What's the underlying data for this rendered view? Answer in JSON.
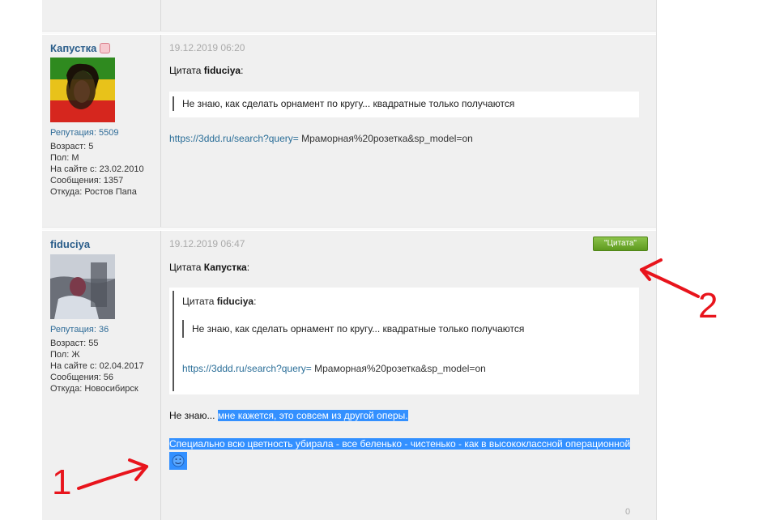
{
  "posts": [
    {
      "author": "Капустка",
      "reputation": "Репутация: 5509",
      "stats": [
        "Возраст: 5",
        "Пол: М",
        "На сайте с: 23.02.2010",
        "Сообщения: 1357",
        "Откуда: Ростов Папа"
      ],
      "date": "19.12.2019 06:20",
      "quote_prefix": "Цитата",
      "quote_author": "fiduciya",
      "quote_text": "Не знаю, как сделать орнамент по кругу... квадратные только получаются",
      "link_text": "https://3ddd.ru/search?query=",
      "link_tail": " Мраморная%20розетка&sp_model=on"
    },
    {
      "author": "fiduciya",
      "reputation": "Репутация: 36",
      "stats": [
        "Возраст: 55",
        "Пол: Ж",
        "На сайте с: 02.04.2017",
        "Сообщения: 56",
        "Откуда: Новосибирск"
      ],
      "date": "19.12.2019 06:47",
      "quote_button": "\"Цитата\"",
      "quote_prefix": "Цитата",
      "quote_author": "Капустка",
      "inner_quote_prefix": "Цитата",
      "inner_quote_author": "fiduciya",
      "inner_quote_text": "Не знаю, как сделать орнамент по кругу... квадратные только получаются",
      "inner_link_text": "https://3ddd.ru/search?query=",
      "inner_link_tail": "  Мраморная%20розетка&sp_model=on",
      "reply_plain": "Не знаю... ",
      "reply_highlight": "мне кажется, это совсем из другой оперы.",
      "reply_highlight_2": "Специально всю цветность убирала - все беленько - чистенько - как в высококлассной операционной",
      "counter": "0"
    }
  ],
  "annotations": {
    "label_1": "1",
    "label_2": "2",
    "color": "#e8141c"
  }
}
